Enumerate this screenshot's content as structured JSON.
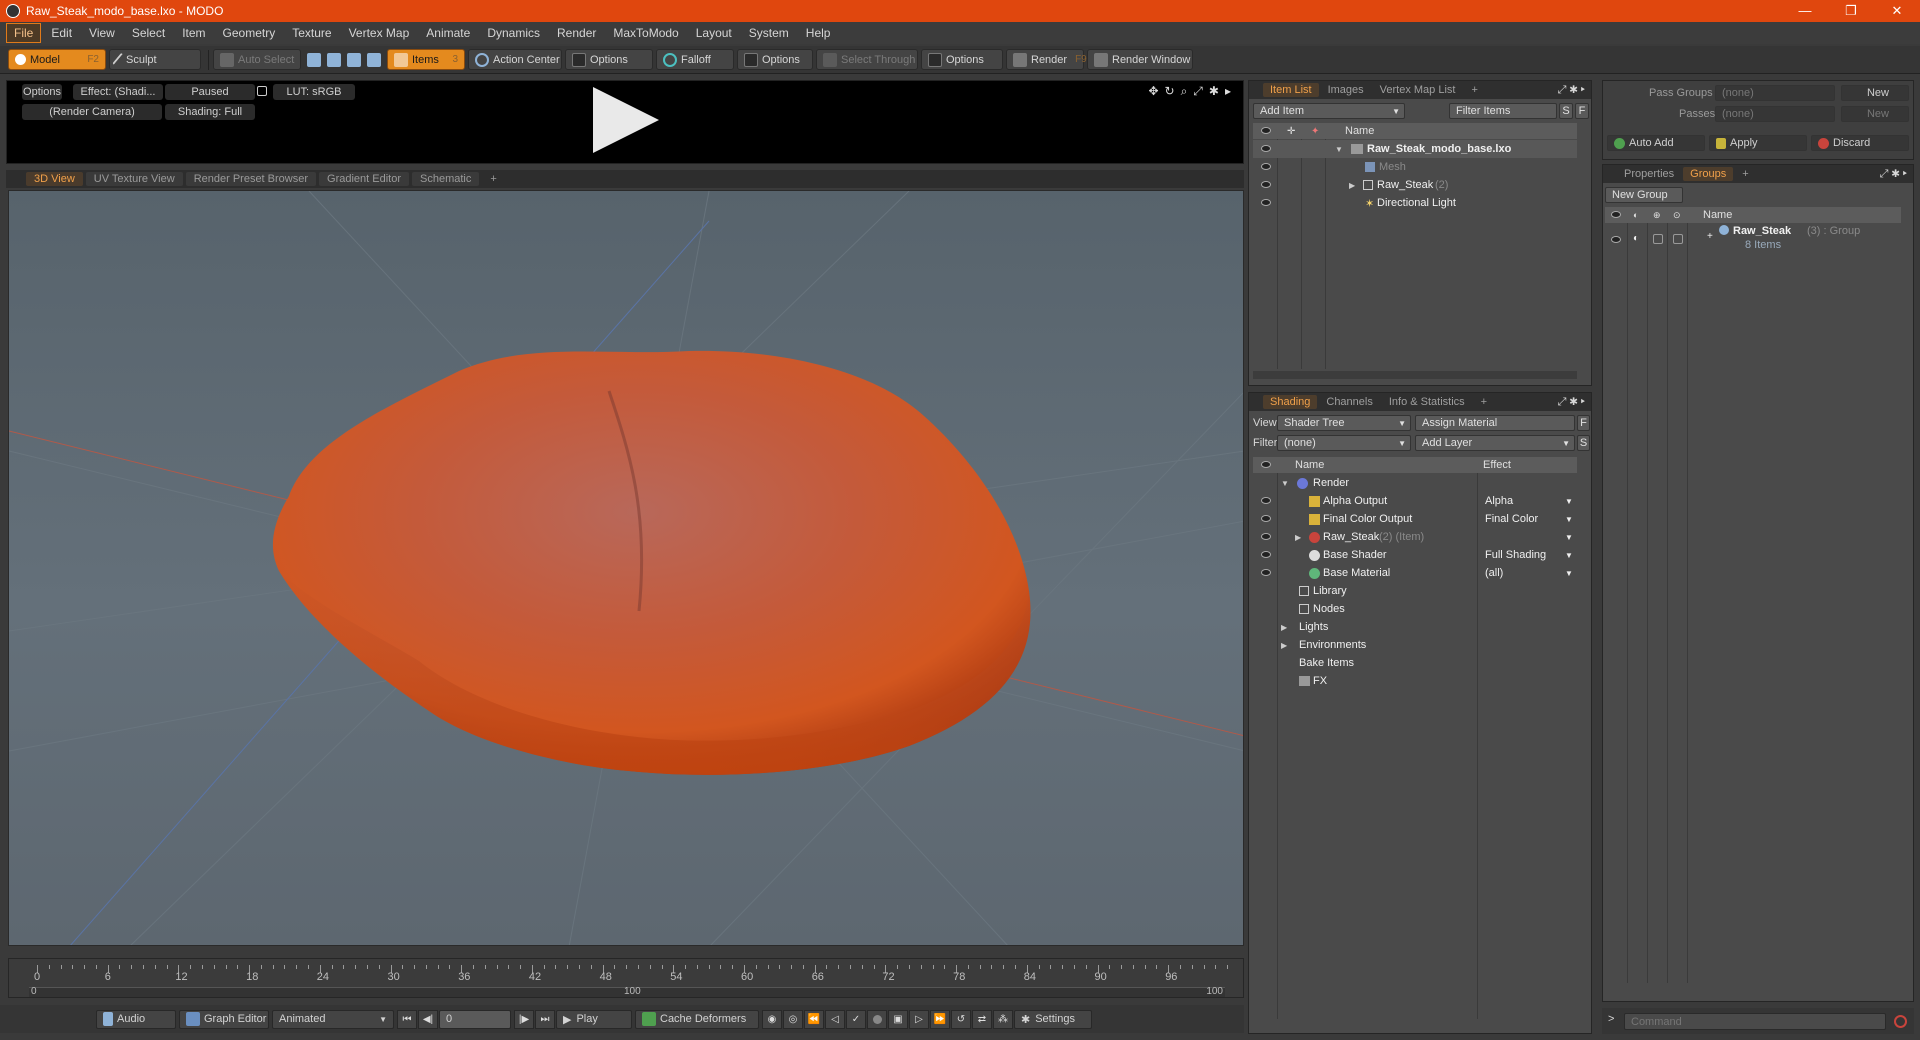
{
  "window": {
    "title": "Raw_Steak_modo_base.lxo - MODO",
    "controls": [
      "—",
      "❐",
      "✕"
    ]
  },
  "menu": [
    "File",
    "Edit",
    "View",
    "Select",
    "Item",
    "Geometry",
    "Texture",
    "Vertex Map",
    "Animate",
    "Dynamics",
    "Render",
    "MaxToModo",
    "Layout",
    "System",
    "Help"
  ],
  "toolbar": {
    "model": "Model",
    "model_key": "F2",
    "sculpt": "Sculpt",
    "auto_select": "Auto Select",
    "items": "Items",
    "items_key": "3",
    "action_center": "Action Center",
    "options1": "Options",
    "falloff": "Falloff",
    "options2": "Options",
    "select_through": "Select Through",
    "options3": "Options",
    "render": "Render",
    "render_key": "F9",
    "render_window": "Render Window"
  },
  "preview": {
    "options": "Options",
    "effect": "Effect: (Shadi...",
    "paused": "Paused",
    "lut": "LUT: sRGB",
    "camera": "(Render Camera)",
    "shading": "Shading: Full"
  },
  "viewtabs": [
    "3D View",
    "UV Texture View",
    "Render Preset Browser",
    "Gradient Editor",
    "Schematic",
    "+"
  ],
  "timeline": {
    "ticks": [
      "0",
      "6",
      "12",
      "18",
      "24",
      "30",
      "36",
      "42",
      "48",
      "54",
      "60",
      "66",
      "72",
      "78",
      "84",
      "90",
      "96"
    ],
    "mid": "100",
    "end": "100",
    "start": "0"
  },
  "playbar": {
    "audio": "Audio",
    "graph_editor": "Graph Editor",
    "animated": "Animated",
    "frame": "0",
    "play": "Play",
    "cache": "Cache Deformers",
    "settings": "Settings"
  },
  "itemlist": {
    "tabs": [
      "Item List",
      "Images",
      "Vertex Map List",
      "+"
    ],
    "add_item": "Add Item",
    "filter_items": "Filter Items",
    "s": "S",
    "f": "F",
    "col_name": "Name",
    "items": [
      {
        "name": "Raw_Steak_modo_base.lxo",
        "extra": ""
      },
      {
        "name": "Mesh",
        "extra": ""
      },
      {
        "name": "Raw_Steak",
        "extra": "(2)"
      },
      {
        "name": "Directional Light",
        "extra": ""
      }
    ]
  },
  "shading": {
    "tabs": [
      "Shading",
      "Channels",
      "Info & Statistics",
      "+"
    ],
    "view_label": "View",
    "view_value": "Shader Tree",
    "assign_material": "Assign Material",
    "f": "F",
    "filter_label": "Filter",
    "filter_value": "(none)",
    "add_layer": "Add Layer",
    "s": "S",
    "col_name": "Name",
    "col_effect": "Effect",
    "rows": [
      {
        "name": "Render",
        "extra": "",
        "effect": ""
      },
      {
        "name": "Alpha Output",
        "extra": "",
        "effect": "Alpha"
      },
      {
        "name": "Final Color Output",
        "extra": "",
        "effect": "Final Color"
      },
      {
        "name": "Raw_Steak",
        "extra": "(2) (Item)",
        "effect": ""
      },
      {
        "name": "Base Shader",
        "extra": "",
        "effect": "Full Shading"
      },
      {
        "name": "Base Material",
        "extra": "",
        "effect": "(all)"
      },
      {
        "name": "Library",
        "extra": "",
        "effect": ""
      },
      {
        "name": "Nodes",
        "extra": "",
        "effect": ""
      },
      {
        "name": "Lights",
        "extra": "",
        "effect": ""
      },
      {
        "name": "Environments",
        "extra": "",
        "effect": ""
      },
      {
        "name": "Bake Items",
        "extra": "",
        "effect": ""
      },
      {
        "name": "FX",
        "extra": "",
        "effect": ""
      }
    ]
  },
  "passes": {
    "pass_groups_label": "Pass Groups",
    "pass_groups_value": "(none)",
    "new1": "New",
    "passes_label": "Passes",
    "passes_value": "(none)",
    "new2": "New",
    "auto_add": "Auto Add",
    "apply": "Apply",
    "discard": "Discard"
  },
  "groups": {
    "tabs": [
      "Properties",
      "Groups",
      "+"
    ],
    "new_group": "New Group",
    "col_name": "Name",
    "group_name": "Raw_Steak",
    "group_extra": "(3) : Group",
    "group_items": "8 Items"
  },
  "command": {
    "placeholder": "Command"
  },
  "colors": {
    "accent": "#e0470e",
    "tab_active": "#f0a04a",
    "steak": "#d4552a"
  }
}
